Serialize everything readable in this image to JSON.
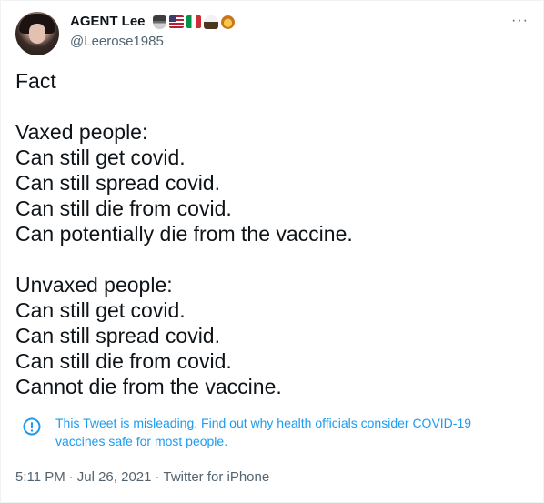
{
  "user": {
    "display_name": "AGENT Lee",
    "handle": "@Leerose1985",
    "emoji": [
      "detective-emoji",
      "us-flag-emoji",
      "italy-flag-emoji",
      "eagle-emoji",
      "lion-emoji"
    ]
  },
  "more_label": "···",
  "tweet": {
    "lines": [
      "Fact",
      "",
      "Vaxed people:",
      "Can still get covid.",
      "Can still spread covid.",
      "Can still die from covid.",
      "Can potentially die from the vaccine.",
      "",
      "Unvaxed people:",
      "Can still get covid.",
      "Can still spread covid.",
      "Can still die from covid.",
      "Cannot die from the vaccine."
    ]
  },
  "notice": {
    "icon": "exclamation-circle-icon",
    "text": "This Tweet is misleading. Find out why health officials consider COVID-19 vaccines safe for most people."
  },
  "meta": {
    "time": "5:11 PM",
    "separator": "·",
    "date": "Jul 26, 2021",
    "source": "Twitter for iPhone"
  },
  "colors": {
    "link_blue": "#1d9bf0",
    "secondary_text": "#536471",
    "primary_text": "#0f1419",
    "divider": "#eff3f4"
  }
}
